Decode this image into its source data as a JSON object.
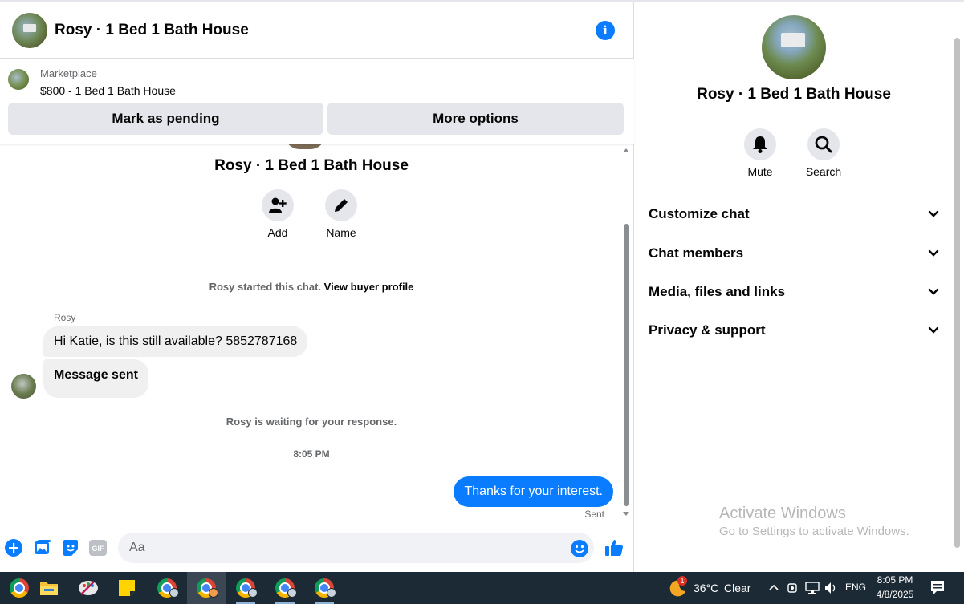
{
  "header": {
    "title": "Rosy · 1 Bed 1 Bath House",
    "info_icon": "info-icon"
  },
  "marketplace": {
    "label": "Marketplace",
    "listing": "$800 - 1 Bed 1 Bath House",
    "mark_pending": "Mark as pending",
    "more_options": "More options"
  },
  "thread": {
    "title": "Rosy · 1 Bed 1 Bath House",
    "add_label": "Add",
    "name_label": "Name",
    "started_text": "Rosy started this chat.",
    "view_profile": "View buyer profile",
    "sender_name": "Rosy",
    "messages": [
      {
        "from": "Rosy",
        "text": "Hi Katie, is this still available? 5852787168"
      },
      {
        "from": "Rosy",
        "text": "Message sent"
      }
    ],
    "waiting_text": "Rosy is waiting for your response.",
    "timestamp": "8:05 PM",
    "outgoing": "Thanks for your interest.",
    "status": "Sent"
  },
  "composer": {
    "placeholder": "Aa",
    "icons": [
      "plus-icon",
      "photo-icon",
      "sticker-icon",
      "gif-icon",
      "emoji-icon",
      "thumbs-up-icon"
    ],
    "gif_label": "GIF"
  },
  "details": {
    "title": "Rosy · 1 Bed 1 Bath House",
    "mute_label": "Mute",
    "search_label": "Search",
    "sections": [
      "Customize chat",
      "Chat members",
      "Media, files and links",
      "Privacy & support"
    ]
  },
  "watermark": {
    "line1": "Activate Windows",
    "line2": "Go to Settings to activate Windows."
  },
  "taskbar": {
    "weather_temp": "36°C",
    "weather_text": "Clear",
    "notification_count": "1",
    "language": "ENG",
    "time": "8:05 PM",
    "date": "4/8/2025"
  },
  "colors": {
    "messenger_blue": "#0a7cff",
    "bubble_gray": "#f0f0f0",
    "button_gray": "#e4e6eb",
    "taskbar": "#1c2a35"
  }
}
